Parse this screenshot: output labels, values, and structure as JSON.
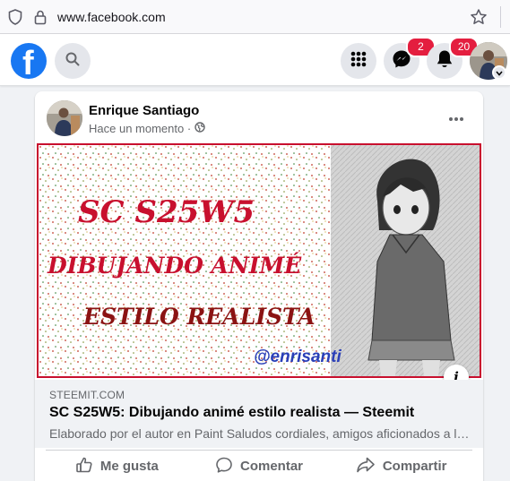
{
  "browser": {
    "url": "www.facebook.com"
  },
  "nav": {
    "messenger_badge": "2",
    "notifications_badge": "20"
  },
  "post": {
    "author": "Enrique Santiago",
    "time": "Hace un momento ·",
    "link": {
      "image_lines": [
        "SC S25W5",
        "DIBUJANDO ANIMÉ",
        "ESTILO REALISTA",
        "@enrisanti"
      ],
      "domain": "STEEMIT.COM",
      "title": "SC S25W5: Dibujando animé estilo realista — Steemit",
      "description": "Elaborado por el autor en Paint Saludos cordiales, amigos aficionados a la fotografía y al dibujo"
    },
    "actions": {
      "like": "Me gusta",
      "comment": "Comentar",
      "share": "Compartir"
    }
  },
  "colors": {
    "facebook_blue": "#1877f2",
    "badge_red": "#e41e3f",
    "image_title_red": "#c8102e",
    "image_handle_blue": "#2a3fb8"
  }
}
